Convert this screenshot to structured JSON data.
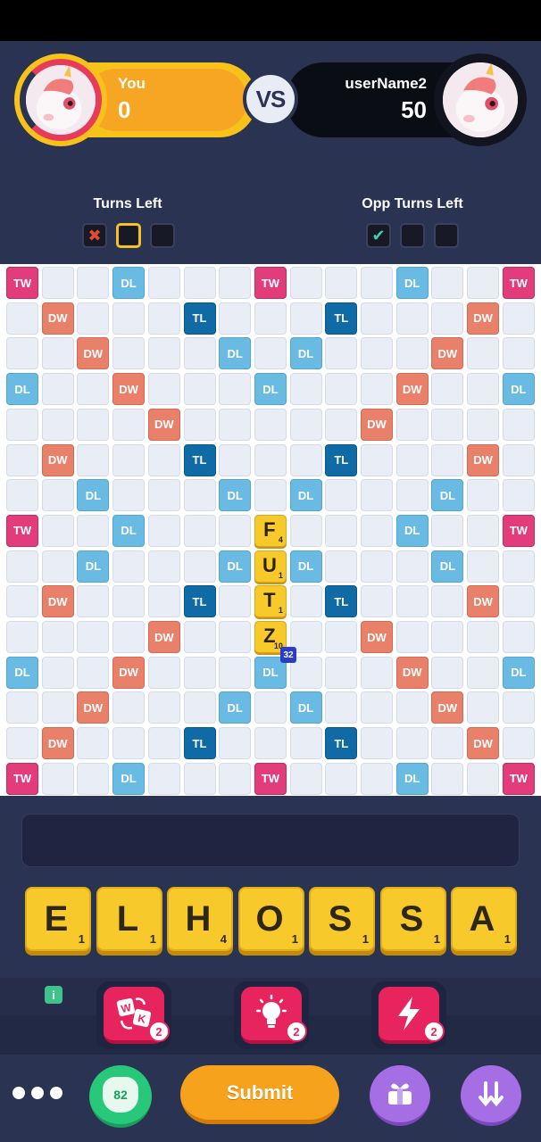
{
  "header": {
    "you": {
      "name": "You",
      "score": "0"
    },
    "vs": "VS",
    "opponent": {
      "name": "userName2",
      "score": "50"
    },
    "turns_left_label": "Turns Left",
    "opp_turns_left_label": "Opp Turns Left",
    "you_turns": [
      "used",
      "current",
      "empty"
    ],
    "opp_turns": [
      "done",
      "empty",
      "empty"
    ]
  },
  "board": {
    "size": 15,
    "rows": [
      "TW,,,DL,,,,TW,,,,DL,,,TW",
      ",DW,,,,TL,,,,TL,,,,DW,",
      ",,DW,,,,DL,,DL,,,,DW,,",
      "DL,,,DW,,,,DL,,,,DW,,,DL",
      ",,,,DW,,,,,,DW,,,,",
      ",DW,,,,TL,,,,TL,,,,DW,",
      ",,DL,,,,DL,,DL,,,,DL,,",
      "TW,,,DL,,,,,,,,DL,,,TW",
      ",,DL,,,,DL,,DL,,,,DL,,",
      ",DW,,,,TL,,,,TL,,,,DW,",
      ",,,,DW,,,,,,DW,,,,",
      "DL,,,DW,,,,DL,,,,DW,,,DL",
      ",,DW,,,,DL,,DL,,,,DW,,",
      ",DW,,,,TL,,,,TL,,,,DW,",
      "TW,,,DL,,,,TW,,,,DL,,,TW"
    ],
    "placed_tiles": [
      {
        "row": 7,
        "col": 7,
        "letter": "F",
        "points": "4"
      },
      {
        "row": 8,
        "col": 7,
        "letter": "U",
        "points": "1"
      },
      {
        "row": 9,
        "col": 7,
        "letter": "T",
        "points": "1"
      },
      {
        "row": 10,
        "col": 7,
        "letter": "Z",
        "points": "10"
      }
    ],
    "score_preview": "32"
  },
  "rack": [
    {
      "letter": "E",
      "points": "1"
    },
    {
      "letter": "L",
      "points": "1"
    },
    {
      "letter": "H",
      "points": "4"
    },
    {
      "letter": "O",
      "points": "1"
    },
    {
      "letter": "S",
      "points": "1"
    },
    {
      "letter": "S",
      "points": "1"
    },
    {
      "letter": "A",
      "points": "1"
    }
  ],
  "info_badge": "i",
  "powerups": [
    {
      "name": "swap-tiles",
      "icon": "swap-tiles-icon",
      "count": "2"
    },
    {
      "name": "hint",
      "icon": "lightbulb-icon",
      "count": "2"
    },
    {
      "name": "boost",
      "icon": "lightning-icon",
      "count": "2"
    }
  ],
  "actions": {
    "coins": "82",
    "submit_label": "Submit"
  },
  "colors": {
    "TW": "#e23c7a",
    "DW": "#e9806a",
    "DL": "#69bbe4",
    "TL": "#0f6aa6",
    "tile": "#f7c92a",
    "submit": "#f7a21c",
    "powerup": "#e8245e",
    "coins": "#27c879",
    "round": "#a56ee4"
  }
}
